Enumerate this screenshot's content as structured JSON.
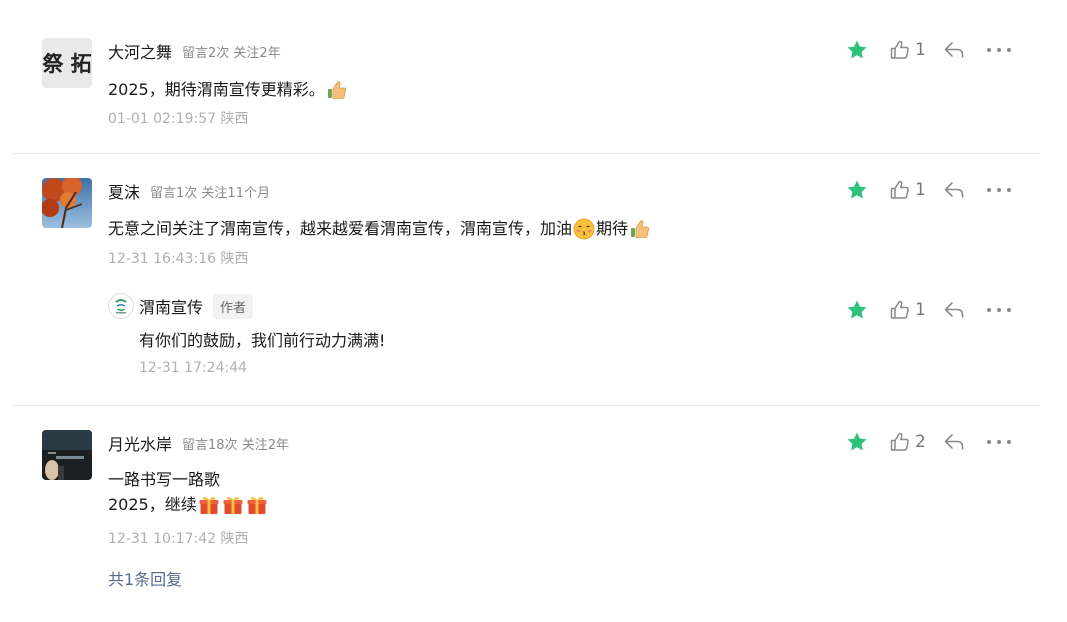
{
  "comments": [
    {
      "name": "大河之舞",
      "stats": "留言2次 关注2年",
      "content_line1": "2025，期待渭南宣传更精彩。",
      "time": "01-01 02:19:57 陕西",
      "likes": "1",
      "avatar_glyph": "祭 拓",
      "emojis": [
        "thumbs-up-icon"
      ]
    },
    {
      "name": "夏沫",
      "stats": "留言1次 关注11个月",
      "content_part1": "无意之间关注了渭南宣传，越来越爱看渭南宣传，渭南宣传，加油",
      "content_part2": "期待",
      "time": "12-31 16:43:16 陕西",
      "likes": "1",
      "emojis": [
        "smooch-face-icon",
        "thumbs-up-icon"
      ]
    },
    {
      "name": "渭南宣传",
      "author_tag": "作者",
      "content_line1": "有你们的鼓励，我们前行动力满满!",
      "time": "12-31 17:24:44",
      "likes": "1"
    },
    {
      "name": "月光水岸",
      "stats": "留言18次 关注2年",
      "content_line1": "一路书写一路歌",
      "content_line2": "2025，继续",
      "time": "12-31 10:17:42 陕西",
      "likes": "2",
      "emojis": [
        "gift-icon",
        "gift-icon",
        "gift-icon"
      ]
    }
  ],
  "reply_link": "共1条回复",
  "colors": {
    "star": "#2ec27e",
    "icon_gray": "#8a8a8a",
    "link": "#576b95",
    "divider": "#e6e6e6"
  }
}
